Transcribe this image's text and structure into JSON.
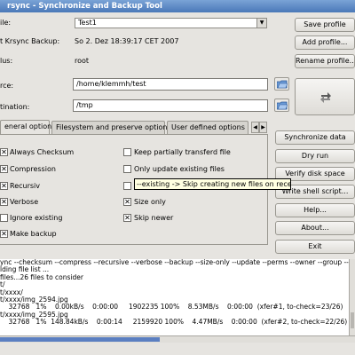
{
  "window": {
    "title": "rsync - Synchronize and Backup Tool"
  },
  "profile": {
    "label": "ile:",
    "value": "Test1"
  },
  "last_backup": {
    "label": "t Krsync Backup:",
    "value": "So 2. Dez 18:39:17 CET 2007"
  },
  "user": {
    "label": "lus:",
    "value": "root"
  },
  "source": {
    "label": "rce:",
    "value": "/home/klemmh/test"
  },
  "destination": {
    "label": "tination:",
    "value": "/tmp"
  },
  "buttons": {
    "save_profile": "Save profile",
    "add_profile": "Add profile...",
    "rename_profile": "Rename profile...",
    "synchronize_data": "Synchronize data",
    "dry_run": "Dry run",
    "verify_disk_space": "Verify disk space",
    "write_shell_script": "Write shell script...",
    "help": "Help...",
    "about": "About...",
    "exit": "Exit"
  },
  "tabs": [
    "eneral options",
    "Filesystem and preserve options",
    "User defined options"
  ],
  "options_left": [
    {
      "label": "Always Checksum",
      "checked": true
    },
    {
      "label": "Compression",
      "checked": true
    },
    {
      "label": "Recursiv",
      "checked": true
    },
    {
      "label": "Verbose",
      "checked": true
    },
    {
      "label": "Ignore existing",
      "checked": false
    },
    {
      "label": "Make backup",
      "checked": true
    }
  ],
  "options_right": [
    {
      "label": "Keep partially transferd file",
      "checked": false
    },
    {
      "label": "Only update existing files",
      "checked": false
    },
    {
      "label": "",
      "checked": false
    },
    {
      "label": "Size only",
      "checked": true
    },
    {
      "label": "Skip newer",
      "checked": true
    }
  ],
  "tooltip": "--existing -> Skip creating new files on receiver",
  "log_lines": [
    "ync --checksum --compress --recursive --verbose --backup --size-only --update --perms --owner --group --times --",
    "lding file list ...",
    "files...26 files to consider",
    "t/",
    "t/xxxx/",
    "t/xxxx/img_2594.jpg",
    "    32768   1%    0.00kB/s    0:00:00     1902235 100%    8.53MB/s    0:00:00  (xfer#1, to-check=23/26)",
    "t/xxxx/img_2595.jpg",
    "    32768   1%  148.84kB/s    0:00:14     2159920 100%    4.47MB/s    0:00:00  (xfer#2, to-check=22/26)"
  ]
}
